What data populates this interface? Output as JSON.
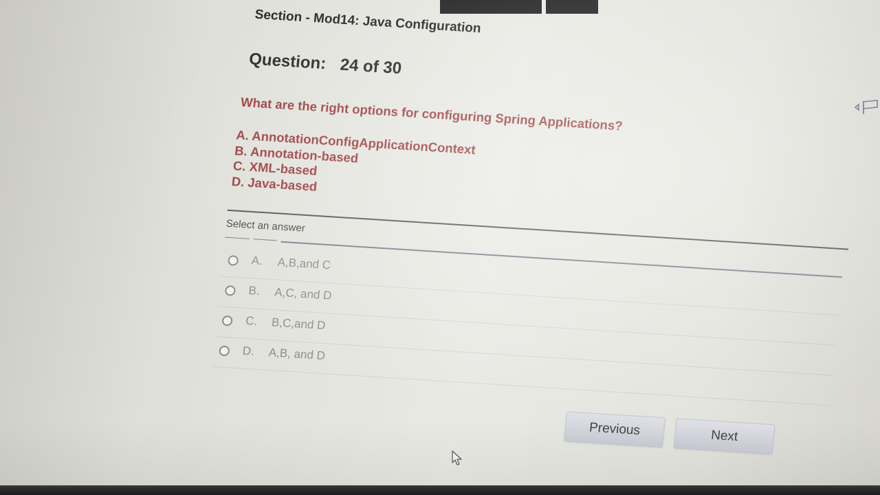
{
  "header": {
    "section_title": "Section - Mod14: Java Configuration",
    "question_label": "Question:",
    "question_counter": "24 of 30"
  },
  "question": {
    "text": "What are the right options for configuring Spring Applications?",
    "options": [
      "A. AnnotationConfigApplicationContext",
      "B. Annotation-based",
      "C. XML-based",
      "D. Java-based"
    ]
  },
  "answers": {
    "prompt": "Select an answer",
    "choices": [
      {
        "letter": "A.",
        "text": "A,B,and C"
      },
      {
        "letter": "B.",
        "text": "A,C, and D"
      },
      {
        "letter": "C.",
        "text": "B,C,and D"
      },
      {
        "letter": "D.",
        "text": "A,B, and D"
      }
    ]
  },
  "navigation": {
    "previous_label": "Previous",
    "next_label": "Next"
  },
  "icons": {
    "flag": "flag-icon",
    "cursor": "mouse-pointer-icon",
    "radio": "radio-button-icon"
  },
  "colors": {
    "question_text": "#9b3f3f",
    "heading_text": "#2a2a2a",
    "answer_text": "#8d8d8d",
    "button_bg": "#d4d6dc",
    "divider": "#53535a"
  }
}
